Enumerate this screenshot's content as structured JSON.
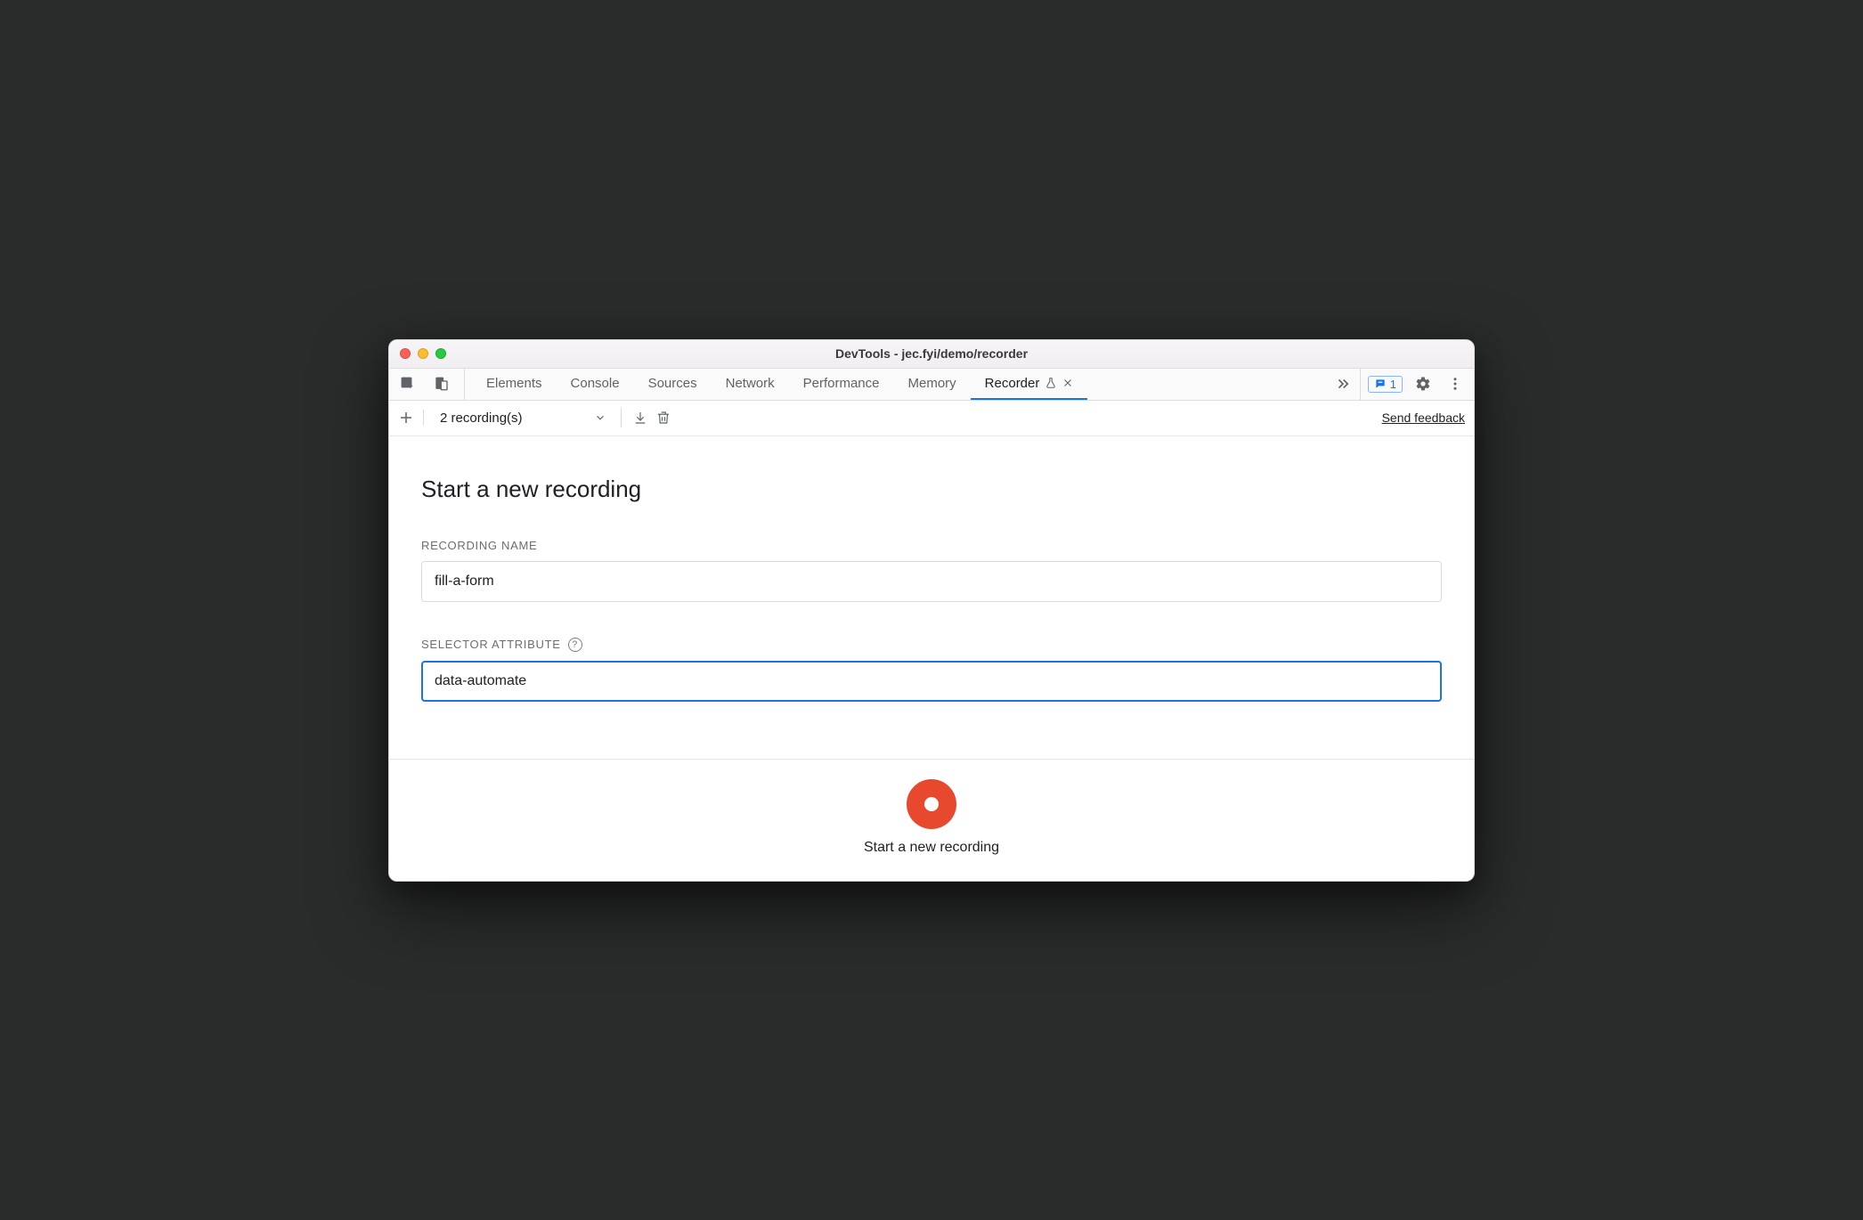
{
  "window": {
    "title": "DevTools - jec.fyi/demo/recorder"
  },
  "tabs": {
    "items": [
      {
        "label": "Elements"
      },
      {
        "label": "Console"
      },
      {
        "label": "Sources"
      },
      {
        "label": "Network"
      },
      {
        "label": "Performance"
      },
      {
        "label": "Memory"
      },
      {
        "label": "Recorder",
        "active": true,
        "experimental": true,
        "closable": true
      }
    ],
    "issues_count": "1"
  },
  "toolbar": {
    "dropdown_label": "2 recording(s)",
    "feedback_label": "Send feedback"
  },
  "content": {
    "heading": "Start a new recording",
    "recording_name_label": "Recording Name",
    "recording_name_value": "fill-a-form",
    "selector_attr_label": "Selector Attribute",
    "selector_attr_value": "data-automate"
  },
  "footer": {
    "record_label": "Start a new recording"
  }
}
